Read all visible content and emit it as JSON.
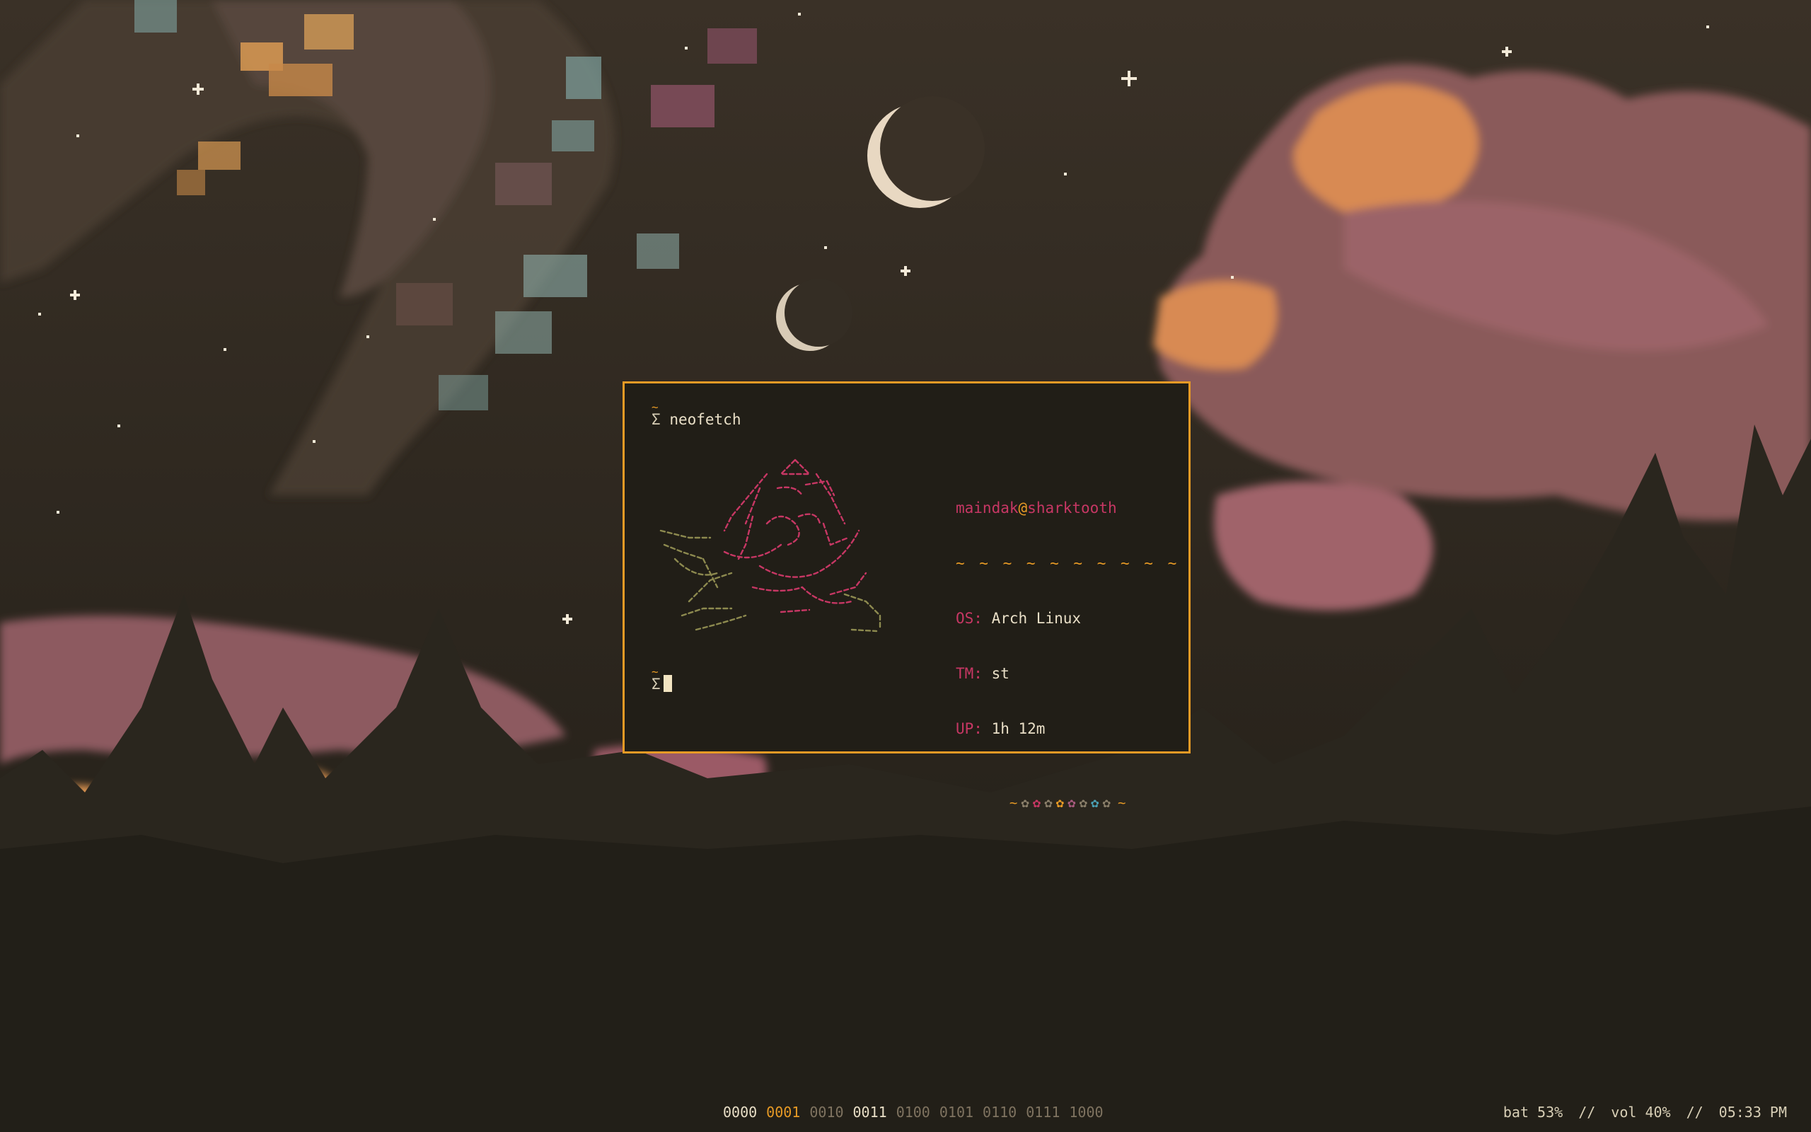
{
  "terminal": {
    "lines": {
      "tilde_1": "~",
      "prompt_symbol": "Σ",
      "command": "neofetch",
      "tilde_2": "~",
      "prompt_symbol_2": "Σ"
    },
    "neofetch": {
      "user": "maindak",
      "at": "@",
      "host": "sharktooth",
      "separator": "~ ~ ~ ~ ~ ~ ~ ~ ~ ~",
      "rows": [
        {
          "key": "OS:",
          "value": "Arch Linux"
        },
        {
          "key": "TM:",
          "value": "st"
        },
        {
          "key": "UP:",
          "value": "1h 12m"
        }
      ],
      "palette_edge": "~",
      "palette_glyph": "✿",
      "palette_colors": [
        "#8a7f6a",
        "#c73764",
        "#8a7f6a",
        "#e79a25",
        "#a85a7e",
        "#8a7f6a",
        "#4aa0b4",
        "#8a7f6a"
      ]
    },
    "ascii_art": {
      "rose_color": "#c73764",
      "leaf_color": "#8d8a4f"
    }
  },
  "statusbar": {
    "workspaces": [
      {
        "label": "0000",
        "state": "occupied"
      },
      {
        "label": "0001",
        "state": "focused"
      },
      {
        "label": "0010",
        "state": "empty"
      },
      {
        "label": "0011",
        "state": "occupied"
      },
      {
        "label": "0100",
        "state": "empty"
      },
      {
        "label": "0101",
        "state": "empty"
      },
      {
        "label": "0110",
        "state": "empty"
      },
      {
        "label": "0111",
        "state": "empty"
      },
      {
        "label": "1000",
        "state": "empty"
      }
    ],
    "battery": "bat 53%",
    "separator": "//",
    "volume": "vol 40%",
    "clock": "05:33 PM"
  },
  "colors": {
    "accent": "#e79a25",
    "background": "#211e17",
    "foreground": "#e9dfc7",
    "rose": "#c73764"
  }
}
